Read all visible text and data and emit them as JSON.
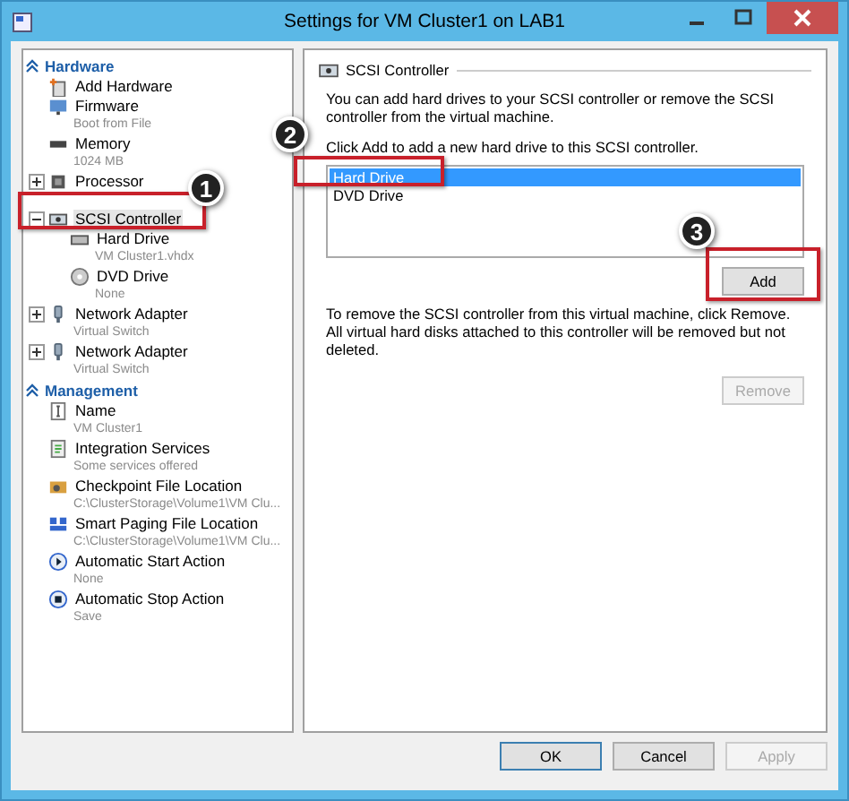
{
  "window": {
    "title": "Settings for VM Cluster1 on LAB1"
  },
  "sidebar": {
    "sections": [
      {
        "title": "Hardware",
        "expanded": true,
        "items": [
          {
            "label": "Add Hardware",
            "kind": "add",
            "selected": false
          },
          {
            "label": "Firmware",
            "sublabel": "Boot from File",
            "kind": "firmware",
            "selected": false
          },
          {
            "label": "Memory",
            "sublabel": "1024 MB",
            "kind": "memory",
            "selected": false
          },
          {
            "label": "Processor",
            "kind": "processor",
            "expanded": false,
            "selected": false
          },
          {
            "label": "SCSI Controller",
            "kind": "controller",
            "expanded": true,
            "selected": true,
            "children": [
              {
                "label": "Hard Drive",
                "sublabel": "VM Cluster1.vhdx",
                "kind": "disk",
                "selected": false
              },
              {
                "label": "DVD Drive",
                "sublabel": "None",
                "kind": "dvd",
                "selected": false
              }
            ]
          },
          {
            "label": "Network Adapter",
            "sublabel": "Virtual Switch",
            "kind": "network",
            "expanded": false,
            "selected": false
          },
          {
            "label": "Network Adapter",
            "sublabel": "Virtual Switch",
            "kind": "network",
            "expanded": false,
            "selected": false
          }
        ]
      },
      {
        "title": "Management",
        "expanded": true,
        "items": [
          {
            "label": "Name",
            "sublabel": "VM Cluster1",
            "kind": "name",
            "selected": false
          },
          {
            "label": "Integration Services",
            "sublabel": "Some services offered",
            "kind": "integration",
            "selected": false
          },
          {
            "label": "Checkpoint File Location",
            "sublabel": "C:\\ClusterStorage\\Volume1\\VM Clu...",
            "kind": "checkpoint",
            "selected": false
          },
          {
            "label": "Smart Paging File Location",
            "sublabel": "C:\\ClusterStorage\\Volume1\\VM Clu...",
            "kind": "paging",
            "selected": false
          },
          {
            "label": "Automatic Start Action",
            "sublabel": "None",
            "kind": "start",
            "selected": false
          },
          {
            "label": "Automatic Stop Action",
            "sublabel": "Save",
            "kind": "stop",
            "selected": false
          }
        ]
      }
    ]
  },
  "panel": {
    "title": "SCSI Controller",
    "intro": "You can add hard drives to your SCSI controller or remove the SCSI controller from the virtual machine.",
    "instruction": "Click Add to add a new hard drive to this SCSI controller.",
    "drive_list": [
      {
        "label": "Hard Drive",
        "selected": true
      },
      {
        "label": "DVD Drive",
        "selected": false
      }
    ],
    "add_button": "Add",
    "remove_text": "To remove the SCSI controller from this virtual machine, click Remove. All virtual hard disks attached to this controller will be removed but not deleted.",
    "remove_button": {
      "label": "Remove",
      "disabled": true
    }
  },
  "buttons": [
    {
      "label": "OK",
      "disabled": false
    },
    {
      "label": "Cancel",
      "disabled": false
    },
    {
      "label": "Apply",
      "disabled": true
    }
  ],
  "annotations": [
    {
      "number": "1"
    },
    {
      "number": "2"
    },
    {
      "number": "3"
    }
  ]
}
